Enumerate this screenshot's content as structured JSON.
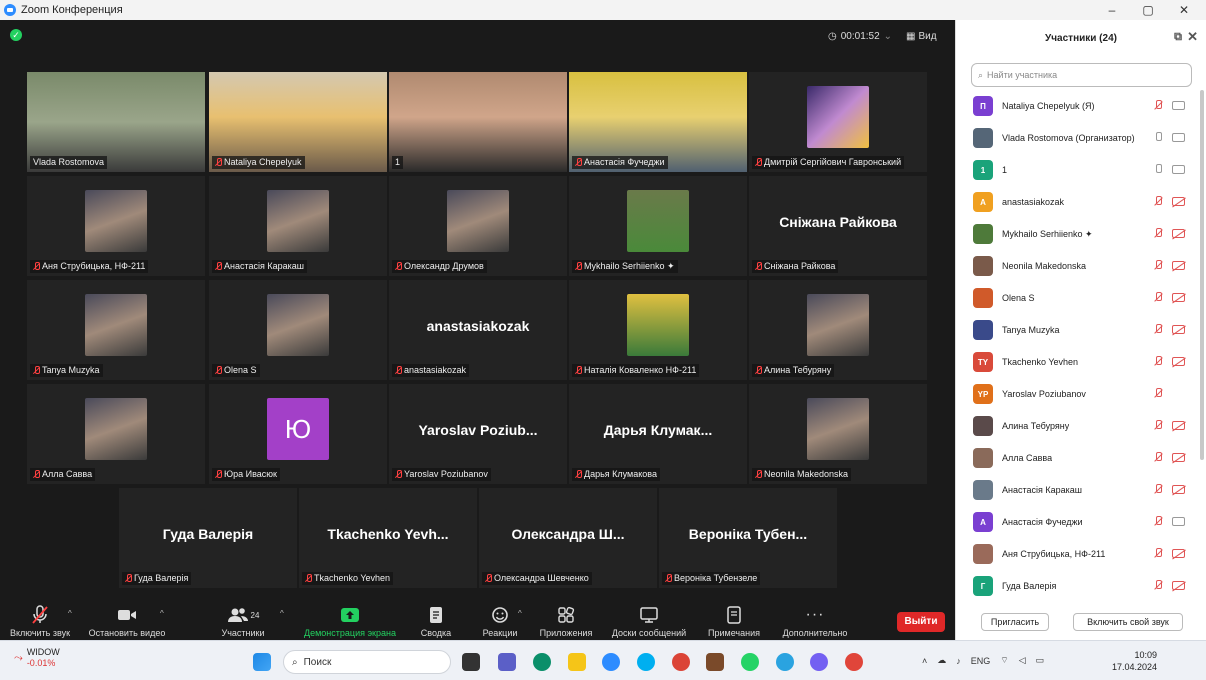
{
  "window": {
    "title": "Zoom Конференция",
    "minimize": "–",
    "maximize": "▢",
    "close": "✕"
  },
  "meeting": {
    "timer": "00:01:52",
    "view_label": "Вид"
  },
  "grid": [
    {
      "label": "Vlada Rostomova",
      "big": "",
      "muted": false,
      "photo": "webcam-woman",
      "active": true
    },
    {
      "label": "Nataliya Chepelyuk",
      "big": "",
      "muted": true,
      "photo": "webcam-woman2"
    },
    {
      "label": "1",
      "big": "",
      "muted": false,
      "photo": "webcam-man"
    },
    {
      "label": "Анастасія Фучеджи",
      "big": "",
      "muted": true,
      "photo": "webcam-woman3"
    },
    {
      "label": "Дмитрій Сергійович Гавронський",
      "big": "",
      "muted": true,
      "photo": "avatar-art"
    },
    {
      "label": "Аня Струбицька, НФ-211",
      "big": "",
      "muted": true,
      "photo": "avatar"
    },
    {
      "label": "Анастасія Каракаш",
      "big": "",
      "muted": true,
      "photo": "avatar"
    },
    {
      "label": "Олександр Друмов",
      "big": "",
      "muted": true,
      "photo": "avatar"
    },
    {
      "label": "Mykhailo Serhiienko ✦",
      "big": "",
      "muted": true,
      "photo": "avatar-frog"
    },
    {
      "label": "Сніжана Райкова",
      "big": "Сніжана Райкова",
      "muted": true
    },
    {
      "label": "Tanya Muzyka",
      "big": "",
      "muted": true,
      "photo": "avatar"
    },
    {
      "label": "Olena S",
      "big": "",
      "muted": true,
      "photo": "avatar"
    },
    {
      "label": "anastasiakozak",
      "big": "anastasiakozak",
      "muted": true
    },
    {
      "label": "Наталія Коваленко НФ-211",
      "big": "",
      "muted": true,
      "photo": "avatar-art2"
    },
    {
      "label": "Алина Тебуряну",
      "big": "",
      "muted": true,
      "photo": "avatar"
    },
    {
      "label": "Алла Савва",
      "big": "",
      "muted": true,
      "photo": "avatar"
    },
    {
      "label": "Юра Ивасюк",
      "big": "",
      "muted": true,
      "letter": "Ю"
    },
    {
      "label": "Yaroslav Poziubanov",
      "big": "Yaroslav Poziub...",
      "muted": true
    },
    {
      "label": "Дарья Клумакова",
      "big": "Дарья Клумак...",
      "muted": true
    },
    {
      "label": "Neonila Makedonska",
      "big": "",
      "muted": true,
      "photo": "avatar"
    },
    {
      "label": "Гуда Валерія",
      "big": "Гуда Валерія",
      "muted": true
    },
    {
      "label": "Tkachenko Yevhen",
      "big": "Tkachenko Yevh...",
      "muted": true
    },
    {
      "label": "Олександра Шевченко",
      "big": "Олександра Ш...",
      "muted": true
    },
    {
      "label": "Вероніка Тубензеле",
      "big": "Вероніка Тубен...",
      "muted": true
    }
  ],
  "toolbar": {
    "unmute": "Включить звук",
    "stop_video": "Остановить видео",
    "participants": "Участники",
    "participants_count": "24",
    "share": "Демонстрация экрана",
    "summary": "Сводка",
    "reactions": "Реакции",
    "apps": "Приложения",
    "whiteboards": "Доски сообщений",
    "notes": "Примечания",
    "more": "Дополнительно",
    "leave": "Выйти"
  },
  "panel": {
    "title": "Участники (24)",
    "search_placeholder": "Найти участника",
    "invite": "Пригласить",
    "unmute_self": "Включить свой звук",
    "items": [
      {
        "name": "Nataliya Chepelyuk (Я)",
        "initial": "П",
        "color": "#7a3fd1",
        "mic": "off",
        "cam": "on"
      },
      {
        "name": "Vlada Rostomova (Организатор)",
        "initial": "",
        "color": "#556677",
        "mic": "on",
        "cam": "on"
      },
      {
        "name": "1",
        "initial": "1",
        "color": "#1aa37a",
        "mic": "on",
        "cam": "on"
      },
      {
        "name": "anastasiakozak",
        "initial": "A",
        "color": "#f0a020",
        "mic": "off",
        "cam": "off"
      },
      {
        "name": "Mykhailo Serhiienko ✦",
        "initial": "",
        "color": "#4e7a3a",
        "mic": "off",
        "cam": "off"
      },
      {
        "name": "Neonila Makedonska",
        "initial": "",
        "color": "#7a5a4a",
        "mic": "off",
        "cam": "off"
      },
      {
        "name": "Olena S",
        "initial": "",
        "color": "#d05a2a",
        "mic": "off",
        "cam": "off"
      },
      {
        "name": "Tanya Muzyka",
        "initial": "",
        "color": "#3a4a8a",
        "mic": "off",
        "cam": "off"
      },
      {
        "name": "Tkachenko Yevhen",
        "initial": "TY",
        "color": "#d94a3a",
        "mic": "off",
        "cam": "off"
      },
      {
        "name": "Yaroslav Poziubanov",
        "initial": "YP",
        "color": "#e0701a",
        "mic": "off",
        "cam": "none"
      },
      {
        "name": "Алина Тебуряну",
        "initial": "",
        "color": "#5a4a4a",
        "mic": "off",
        "cam": "off"
      },
      {
        "name": "Алла Савва",
        "initial": "",
        "color": "#8a6a5a",
        "mic": "off",
        "cam": "off"
      },
      {
        "name": "Анастасія Каракаш",
        "initial": "",
        "color": "#6a7a8a",
        "mic": "off",
        "cam": "off"
      },
      {
        "name": "Анастасія Фучеджи",
        "initial": "A",
        "color": "#7a3fd1",
        "mic": "off",
        "cam": "on"
      },
      {
        "name": "Аня Струбицька, НФ-211",
        "initial": "",
        "color": "#9a6a5a",
        "mic": "off",
        "cam": "off"
      },
      {
        "name": "Гуда Валерія",
        "initial": "Г",
        "color": "#1aa37a",
        "mic": "off",
        "cam": "off"
      }
    ]
  },
  "taskbar": {
    "weather_title": "WIDOW",
    "weather_change": "-0.01%",
    "search": "Поиск",
    "lang": "ENG",
    "time": "10:09",
    "date": "17.04.2024"
  }
}
